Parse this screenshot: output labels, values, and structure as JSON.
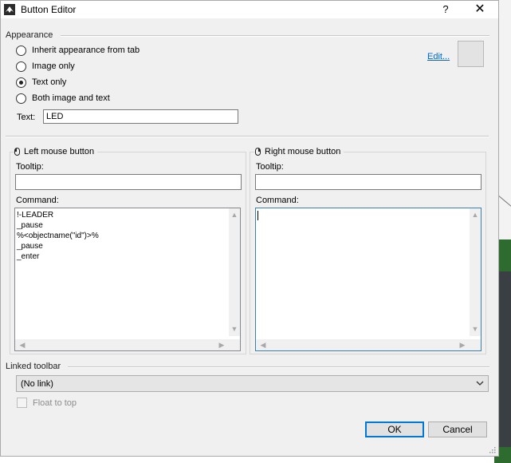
{
  "window": {
    "title": "Button Editor",
    "help_label": "?",
    "close_label": "✕"
  },
  "appearance": {
    "section_label": "Appearance",
    "options": [
      {
        "label": "Inherit appearance from tab",
        "checked": false
      },
      {
        "label": "Image only",
        "checked": false
      },
      {
        "label": "Text only",
        "checked": true
      },
      {
        "label": "Both image and text",
        "checked": false
      }
    ],
    "edit_link": "Edit...",
    "text_label": "Text:",
    "text_value": "LED"
  },
  "left_mouse": {
    "title": "Left mouse button",
    "tooltip_label": "Tooltip:",
    "tooltip_value": "",
    "command_label": "Command:",
    "command_text": "!-LEADER\n_pause\n%<objectname(\"id\")>%\n_pause\n_enter"
  },
  "right_mouse": {
    "title": "Right mouse button",
    "tooltip_label": "Tooltip:",
    "tooltip_value": "",
    "command_label": "Command:",
    "command_text": ""
  },
  "linked_toolbar": {
    "section_label": "Linked toolbar",
    "selected": "(No link)",
    "float_label": "Float to top",
    "float_checked": false
  },
  "buttons": {
    "ok": "OK",
    "cancel": "Cancel"
  },
  "colors": {
    "accent": "#0078d7",
    "link": "#0066cc",
    "dialog_bg": "#f0f0f0"
  }
}
